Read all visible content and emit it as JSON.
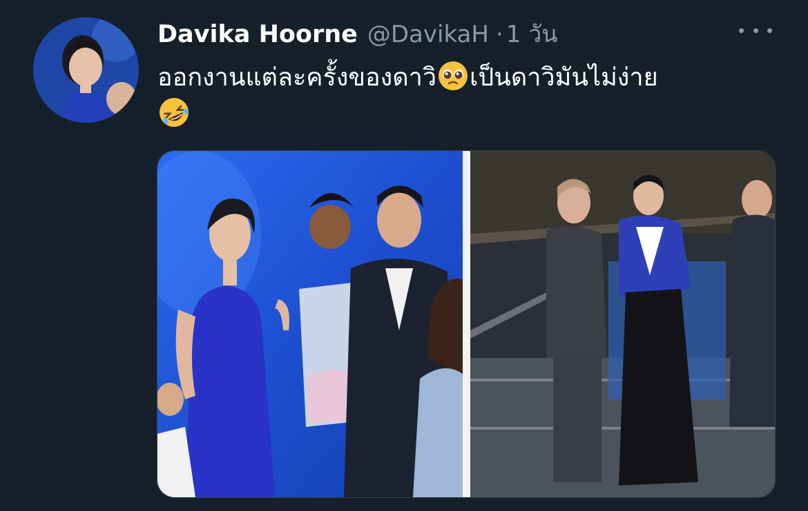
{
  "tweet": {
    "author": {
      "display_name": "Davika Hoorne",
      "handle": "@DavikaH",
      "avatar_icon": "profile-photo"
    },
    "separator": "·",
    "timestamp": "1 วัน",
    "text_line1_part1": "ออกงานแต่ละครั้งของดาวิ",
    "text_line1_part2": "เป็นดาวิมันไม่ง่าย",
    "emojis": [
      "pleading-face-emoji",
      "rolling-on-floor-laughing-emoji"
    ],
    "more_icon": "more-options-icon",
    "media": {
      "photos": [
        "event-photo-left",
        "event-photo-right"
      ]
    }
  },
  "colors": {
    "background": "#15202b",
    "primary_text": "#ffffff",
    "secondary_text": "#8b98a5",
    "border": "#38444d"
  }
}
